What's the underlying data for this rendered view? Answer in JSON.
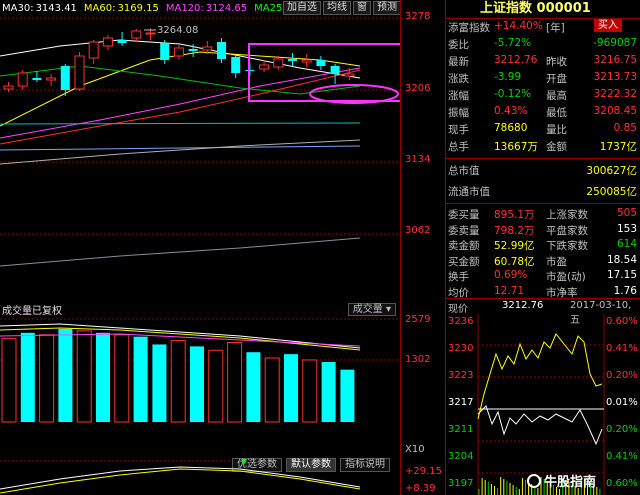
{
  "ma_legend": [
    {
      "label": "MA30:",
      "value": "3143.41",
      "color": "#ffffff"
    },
    {
      "label": "MA60:",
      "value": "3169.15",
      "color": "#ffff00"
    },
    {
      "label": "MA120:",
      "value": "3124.65",
      "color": "#ff44ff"
    },
    {
      "label": "MA25",
      "value": "",
      "color": "#00ff00"
    }
  ],
  "top_tabs": [
    "加自选",
    "均线",
    "窗",
    "预测"
  ],
  "main_chart": {
    "price_axis": [
      "3278",
      "3206",
      "3134",
      "3062"
    ],
    "high_annotation": "3264.08",
    "candles": [
      {
        "o": 3207,
        "c": 3210,
        "h": 3214,
        "l": 3204
      },
      {
        "o": 3210,
        "c": 3223,
        "h": 3226,
        "l": 3206
      },
      {
        "o": 3218,
        "c": 3216,
        "h": 3225,
        "l": 3214
      },
      {
        "o": 3216,
        "c": 3218,
        "h": 3222,
        "l": 3210
      },
      {
        "o": 3230,
        "c": 3206,
        "h": 3232,
        "l": 3200
      },
      {
        "o": 3207,
        "c": 3240,
        "h": 3244,
        "l": 3205
      },
      {
        "o": 3238,
        "c": 3254,
        "h": 3256,
        "l": 3232
      },
      {
        "o": 3250,
        "c": 3258,
        "h": 3261,
        "l": 3246
      },
      {
        "o": 3256,
        "c": 3253,
        "h": 3264,
        "l": 3250
      },
      {
        "o": 3258,
        "c": 3265,
        "h": 3267,
        "l": 3254
      },
      {
        "o": 3262,
        "c": 3263,
        "h": 3268,
        "l": 3256
      },
      {
        "o": 3253,
        "c": 3236,
        "h": 3256,
        "l": 3232
      },
      {
        "o": 3240,
        "c": 3248,
        "h": 3251,
        "l": 3236
      },
      {
        "o": 3247,
        "c": 3245,
        "h": 3252,
        "l": 3239
      },
      {
        "o": 3246,
        "c": 3249,
        "h": 3255,
        "l": 3242
      },
      {
        "o": 3254,
        "c": 3237,
        "h": 3258,
        "l": 3233
      },
      {
        "o": 3239,
        "c": 3223,
        "h": 3240,
        "l": 3218
      },
      {
        "o": 3226,
        "c": 3225,
        "h": 3233,
        "l": 3220
      },
      {
        "o": 3227,
        "c": 3231,
        "h": 3236,
        "l": 3224
      },
      {
        "o": 3229,
        "c": 3237,
        "h": 3240,
        "l": 3226
      },
      {
        "o": 3237,
        "c": 3235,
        "h": 3243,
        "l": 3230
      },
      {
        "o": 3234,
        "c": 3236,
        "h": 3242,
        "l": 3229
      },
      {
        "o": 3236,
        "c": 3230,
        "h": 3240,
        "l": 3226
      },
      {
        "o": 3230,
        "c": 3222,
        "h": 3232,
        "l": 3212
      },
      {
        "o": 3220,
        "c": 3222,
        "h": 3228,
        "l": 3216
      }
    ]
  },
  "volume": {
    "title": "成交量已复权",
    "dropdown": "成交量",
    "axis": [
      "2579",
      "1302",
      "X10"
    ],
    "bars": [
      {
        "v": 2150,
        "up": true
      },
      {
        "v": 2300,
        "up": false
      },
      {
        "v": 2250,
        "up": true
      },
      {
        "v": 2400,
        "up": false
      },
      {
        "v": 2350,
        "up": true
      },
      {
        "v": 2300,
        "up": false
      },
      {
        "v": 2250,
        "up": true
      },
      {
        "v": 2200,
        "up": false
      },
      {
        "v": 2000,
        "up": false
      },
      {
        "v": 2100,
        "up": true
      },
      {
        "v": 1950,
        "up": false
      },
      {
        "v": 1850,
        "up": true
      },
      {
        "v": 2050,
        "up": true
      },
      {
        "v": 1800,
        "up": false
      },
      {
        "v": 1650,
        "up": true
      },
      {
        "v": 1750,
        "up": false
      },
      {
        "v": 1600,
        "up": true
      },
      {
        "v": 1550,
        "up": false
      },
      {
        "v": 1350,
        "up": false
      }
    ]
  },
  "indicator_tabs": [
    "优选参数",
    "默认参数",
    "指标说明"
  ],
  "indicator_axis": [
    "29.15",
    "8.39"
  ],
  "right_panel": {
    "title": "上证指数 000001",
    "rows_a": [
      {
        "l": "添富指数",
        "v": "+14.40%",
        "v2": "[年]"
      },
      {
        "l": "委比",
        "v": "-5.72%",
        "r": "-969087"
      },
      {
        "l": "最新",
        "v": "3212.76",
        "m": "昨收",
        "r": "3216.75"
      },
      {
        "l": "涨跌",
        "v": "-3.99",
        "m": "开盘",
        "r": "3213.73"
      },
      {
        "l": "涨幅",
        "v": "-0.12%",
        "m": "最高",
        "r": "3222.32"
      },
      {
        "l": "振幅",
        "v": "0.43%",
        "m": "最低",
        "r": "3208.45"
      },
      {
        "l": "现手",
        "v": "78680",
        "m": "量比",
        "r": "0.85"
      },
      {
        "l": "总手",
        "v": "13667万",
        "m": "金额",
        "r": "1737亿"
      }
    ],
    "buy_label": "买入",
    "rows_b": [
      {
        "l": "总市值",
        "r": "300627亿"
      },
      {
        "l": "流通市值",
        "r": "250085亿"
      }
    ],
    "rows_c": [
      {
        "l": "委买量",
        "v": "895.1万",
        "m": "上涨家数",
        "r": "505"
      },
      {
        "l": "委卖量",
        "v": "798.2万",
        "m": "平盘家数",
        "r": "153"
      },
      {
        "l": "卖金额",
        "v": "52.99亿",
        "m": "下跌家数",
        "r": "614"
      },
      {
        "l": "买金额",
        "v": "60.78亿",
        "m": "市盈",
        "r": "18.54"
      },
      {
        "l": "换手",
        "v": "0.69%",
        "m": "市盈(动)",
        "r": "17.15"
      },
      {
        "l": "均价",
        "v": "12.71",
        "m": "市净率",
        "r": "1.76"
      }
    ],
    "mini": {
      "label": "现价",
      "price": "3212.76",
      "date": "2017-03-10,五",
      "left_axis": [
        "3236",
        "3230",
        "3223",
        "3217",
        "3211",
        "3204",
        "3197"
      ],
      "right_axis": [
        "0.60%",
        "0.41%",
        "0.20%",
        "0.01%",
        "0.20%",
        "0.41%",
        "0.60%"
      ]
    }
  },
  "watermark": "牛股指南",
  "colors": {
    "up": "#ff3030",
    "down": "#00ffff",
    "accent": "#ffff00",
    "highlight_box": "#ff33ff"
  }
}
